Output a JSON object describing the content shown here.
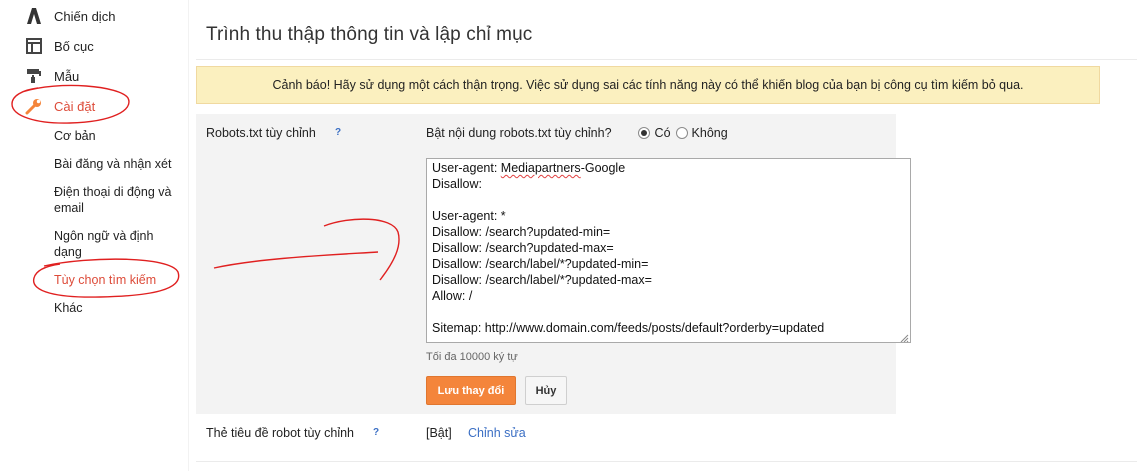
{
  "sidebar": {
    "items": [
      {
        "label": "Chiến dịch",
        "icon": "campaign-icon"
      },
      {
        "label": "Bố cục",
        "icon": "layout-icon"
      },
      {
        "label": "Mẫu",
        "icon": "template-icon"
      },
      {
        "label": "Cài đặt",
        "icon": "wrench-icon",
        "active": true
      }
    ],
    "sub_items": [
      {
        "label": "Cơ bản"
      },
      {
        "label": "Bài đăng và nhận xét"
      },
      {
        "label": "Điện thoại di động và email"
      },
      {
        "label": "Ngôn ngữ và định dạng"
      },
      {
        "label": "Tùy chọn tìm kiếm",
        "active": true
      },
      {
        "label": "Khác"
      }
    ]
  },
  "main": {
    "title": "Trình thu thập thông tin và lập chỉ mục",
    "warning": "Cảnh báo! Hãy sử dụng một cách thận trọng. Việc sử dụng sai các tính năng này có thể khiến blog của bạn bị công cụ tìm kiếm bỏ qua.",
    "robots": {
      "label": "Robots.txt tùy chỉnh",
      "help": "?",
      "question": "Bật nội dung robots.txt tùy chỉnh?",
      "option_yes": "Có",
      "option_no": "Không",
      "selected": "yes",
      "lines": [
        "User-agent: Mediapartners-Google",
        "Disallow:",
        "",
        "User-agent: *",
        "Disallow: /search?updated-min=",
        "Disallow: /search?updated-max=",
        "Disallow: /search/label/*?updated-min=",
        "Disallow: /search/label/*?updated-max=",
        "Allow: /",
        "",
        "Sitemap: http://www.domain.com/feeds/posts/default?orderby=updated"
      ],
      "spell_word": "Mediapartners",
      "max_hint": "Tối đa 10000 ký tự",
      "save_label": "Lưu thay đổi",
      "cancel_label": "Hủy"
    },
    "robot_header": {
      "label": "Thẻ tiêu đề robot tùy chỉnh",
      "help": "?",
      "status": "[Bật]",
      "edit_label": "Chỉnh sửa"
    }
  },
  "colors": {
    "accent": "#dd4b39",
    "save_button": "#f4853b",
    "warning_bg": "#fbf0bf",
    "link": "#3b6fc4",
    "annotation": "#e02020"
  }
}
